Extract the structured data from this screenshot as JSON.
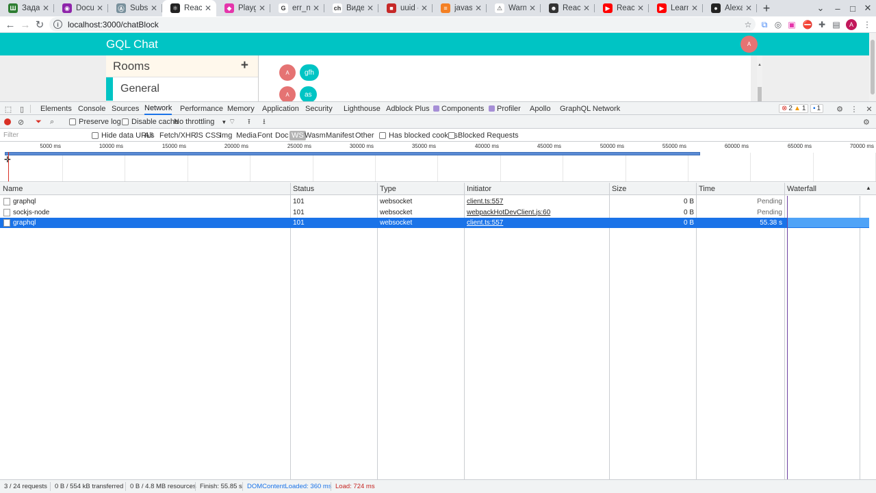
{
  "browser": {
    "tabs": [
      {
        "title": "Задачи",
        "fav_color": "#2e7d32",
        "fav_glyph": "Ш"
      },
      {
        "title": "Docume",
        "fav_color": "#8e24aa",
        "fav_glyph": "◉"
      },
      {
        "title": "Subscrip",
        "fav_color": "#78909c",
        "fav_glyph": "Ⓐ"
      },
      {
        "title": "React Ap",
        "fav_color": "#222222",
        "fav_glyph": "⚛"
      },
      {
        "title": "Playgrou",
        "fav_color": "#e535ab",
        "fav_glyph": "◆"
      },
      {
        "title": "err_nam",
        "fav_color": "#ffffff",
        "fav_glyph": "G"
      },
      {
        "title": "Видеок",
        "fav_color": "#ffffff",
        "fav_glyph": "ch"
      },
      {
        "title": "uuid - np",
        "fav_color": "#c62828",
        "fav_glyph": "■"
      },
      {
        "title": "javascrip",
        "fav_color": "#f48024",
        "fav_glyph": "≡"
      },
      {
        "title": "Warning",
        "fav_color": "#ffffff",
        "fav_glyph": "⚠"
      },
      {
        "title": "React Er",
        "fav_color": "#333333",
        "fav_glyph": "☻"
      },
      {
        "title": "ReactJS",
        "fav_color": "#ff0000",
        "fav_glyph": "▶"
      },
      {
        "title": "Learn Er",
        "fav_color": "#ff0000",
        "fav_glyph": "▶"
      },
      {
        "title": "Alexand",
        "fav_color": "#222222",
        "fav_glyph": "●"
      }
    ],
    "url": "localhost:3000/chatBlock",
    "profile_initial": "A"
  },
  "app": {
    "title": "GQL Chat",
    "avatar": "A",
    "rooms_header": "Rooms",
    "add_glyph": "+",
    "rooms": [
      "General"
    ],
    "messages": [
      {
        "avatar": "A",
        "text": "gfh"
      },
      {
        "avatar": "A",
        "text": "as"
      }
    ]
  },
  "devtools": {
    "tabs": [
      "Elements",
      "Console",
      "Sources",
      "Network",
      "Performance",
      "Memory",
      "Application",
      "Security",
      "Lighthouse",
      "Adblock Plus",
      "Components",
      "Profiler",
      "Apollo",
      "GraphQL Network"
    ],
    "active_tab": "Network",
    "errors": "2",
    "warnings": "1",
    "messages": "1",
    "toolbar": {
      "preserve_log": "Preserve log",
      "disable_cache": "Disable cache",
      "throttling": "No throttling"
    },
    "filter": {
      "placeholder": "Filter",
      "hide_data_urls": "Hide data URLs",
      "types": [
        "All",
        "Fetch/XHR",
        "JS",
        "CSS",
        "Img",
        "Media",
        "Font",
        "Doc",
        "WS",
        "Wasm",
        "Manifest",
        "Other"
      ],
      "selected_type": "WS",
      "has_blocked_cookies": "Has blocked cookies",
      "blocked_requests": "Blocked Requests"
    },
    "overview_ticks": [
      "5000 ms",
      "10000 ms",
      "15000 ms",
      "20000 ms",
      "25000 ms",
      "30000 ms",
      "35000 ms",
      "40000 ms",
      "45000 ms",
      "50000 ms",
      "55000 ms",
      "60000 ms",
      "65000 ms",
      "70000 ms"
    ],
    "columns": [
      "Name",
      "Status",
      "Type",
      "Initiator",
      "Size",
      "Time",
      "Waterfall"
    ],
    "rows": [
      {
        "name": "graphql",
        "status": "101",
        "type": "websocket",
        "initiator": "client.ts:557",
        "size": "0 B",
        "time": "Pending"
      },
      {
        "name": "sockjs-node",
        "status": "101",
        "type": "websocket",
        "initiator": "webpackHotDevClient.js:60",
        "size": "0 B",
        "time": "Pending"
      },
      {
        "name": "graphql",
        "status": "101",
        "type": "websocket",
        "initiator": "client.ts:557",
        "size": "0 B",
        "time": "55.38 s"
      }
    ],
    "selected_row": 2,
    "status": {
      "requests": "3 / 24 requests",
      "transferred": "0 B / 554 kB transferred",
      "resources": "0 B / 4.8 MB resources",
      "finish": "Finish: 55.85 s",
      "dcl": "DOMContentLoaded: 360 ms",
      "load": "Load: 724 ms"
    },
    "colors": {
      "dcl": "#1a73e8",
      "load": "#c5221f",
      "selected": "#1a73e8"
    }
  }
}
